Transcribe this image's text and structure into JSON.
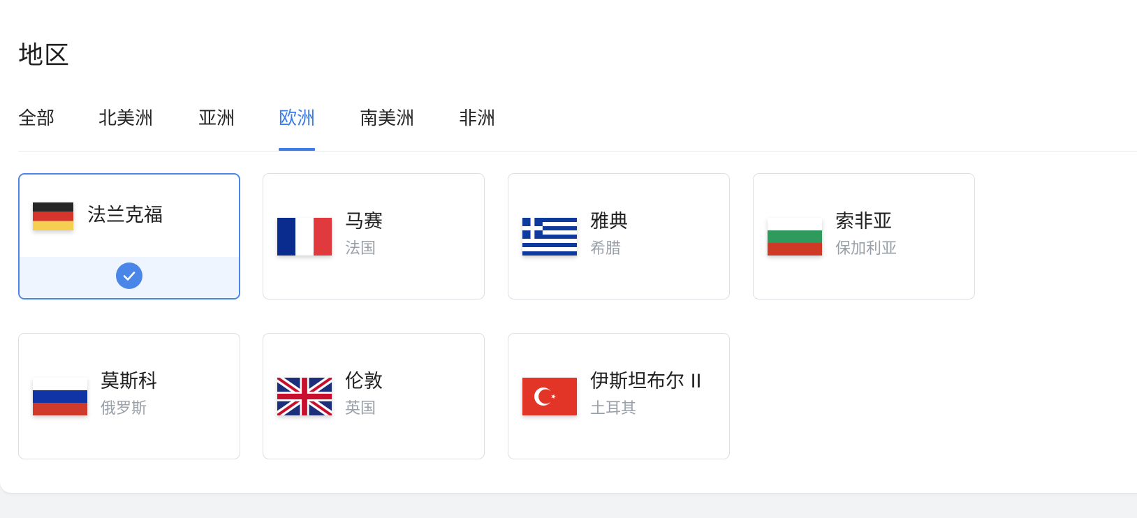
{
  "section": {
    "title": "地区"
  },
  "tabs": [
    {
      "label": "全部",
      "active": false
    },
    {
      "label": "北美洲",
      "active": false
    },
    {
      "label": "亚洲",
      "active": false
    },
    {
      "label": "欧洲",
      "active": true
    },
    {
      "label": "南美洲",
      "active": false
    },
    {
      "label": "非洲",
      "active": false
    }
  ],
  "regions": [
    {
      "city": "法兰克福",
      "country": "",
      "flag": "germany-flag-icon",
      "selected": true
    },
    {
      "city": "马赛",
      "country": "法国",
      "flag": "france-flag-icon",
      "selected": false
    },
    {
      "city": "雅典",
      "country": "希腊",
      "flag": "greece-flag-icon",
      "selected": false
    },
    {
      "city": "索非亚",
      "country": "保加利亚",
      "flag": "bulgaria-flag-icon",
      "selected": false
    },
    {
      "city": "莫斯科",
      "country": "俄罗斯",
      "flag": "russia-flag-icon",
      "selected": false
    },
    {
      "city": "伦敦",
      "country": "英国",
      "flag": "uk-flag-icon",
      "selected": false
    },
    {
      "city": "伊斯坦布尔 II",
      "country": "土耳其",
      "flag": "turkey-flag-icon",
      "selected": false
    }
  ],
  "colors": {
    "accent": "#3d7be6",
    "selected_bg": "#eff5fe",
    "card_border": "#dcdfe3",
    "secondary_text": "#9aa0a8"
  }
}
